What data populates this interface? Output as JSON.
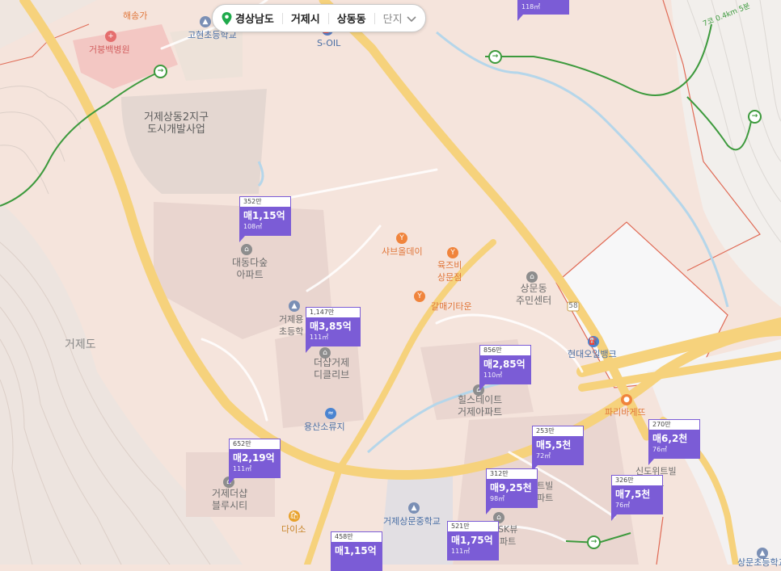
{
  "breadcrumb": {
    "province": "경상남도",
    "city": "거제시",
    "district": "상동동",
    "complex": "단지",
    "location_icon": "location-pin-icon",
    "dropdown_icon": "chevron-down-icon"
  },
  "area_labels": {
    "geojedo": "거제도",
    "dev_project_line1": "거제상동2지구",
    "dev_project_line2": "도시개발사업",
    "trail_distance": "7코 0.4km 5분"
  },
  "road_labels": {
    "route_58": "58"
  },
  "pois": {
    "haesongga": "해송가",
    "hospital": "거붕백병원",
    "gohyeon_school": "고현초등학교",
    "soil": "S-OIL",
    "daedong_apt_line1": "대동다숲",
    "daedong_apt_line2": "아파트",
    "geojeyong_school_line1": "거제용",
    "geojeyong_school_line2": "초등학",
    "shabu": "샤브올데이",
    "yukjeubi_line1": "육즈비",
    "yukjeubi_line2": "상문점",
    "galmaegi": "갈매기타운",
    "sangmun_center_line1": "상문동",
    "sangmun_center_line2": "주민센터",
    "hyundai_oilbank": "현대오일뱅크",
    "the_sharp_line1": "더샵거제",
    "the_sharp_line2": "디클리브",
    "hillstate_line1": "힐스테이트",
    "hillstate_line2": "거제아파트",
    "yongsan_reservoir": "용산소류지",
    "paris_baguette": "파리바게뜨",
    "sharp_bluecity_line1": "거제더샵",
    "sharp_bluecity_line2": "블루시티",
    "daiso": "다이소",
    "sangmun_middle": "거제상문중학교",
    "sk_view_line1": "SK뷰",
    "sk_view_line2": "파트",
    "teubil_line1": "트빌",
    "teubil_line2": "파트",
    "sindo_line1": "신도",
    "sindo_line2": "위트빌",
    "sindo_line3": "파트",
    "sangmun_elem": "상문초등학교"
  },
  "listings": [
    {
      "count": "352만",
      "price": "매1,15억",
      "area": "108㎡"
    },
    {
      "count": "1,147만",
      "price": "매3,85억",
      "area": "111㎡"
    },
    {
      "count": "856만",
      "price": "매2,85억",
      "area": "110㎡"
    },
    {
      "count": "652만",
      "price": "매2,19억",
      "area": "111㎡"
    },
    {
      "count": "253만",
      "price": "매5,5천",
      "area": "72㎡"
    },
    {
      "count": "270만",
      "price": "매6,2천",
      "area": "76㎡"
    },
    {
      "count": "312만",
      "price": "매9,25천",
      "area": "98㎡"
    },
    {
      "count": "326만",
      "price": "매7,5천",
      "area": "76㎡"
    },
    {
      "count": "521만",
      "price": "매1,75억",
      "area": "111㎡"
    },
    {
      "count": "458만",
      "price": "매1,15억",
      "area": ""
    },
    {
      "count": "",
      "price": "",
      "area": "118㎡"
    }
  ],
  "colors": {
    "marker": "#7b5cd6",
    "land": "#f5e4dc",
    "road": "#f6d27c",
    "boundary": "#e06a55",
    "trail": "#3d9a3d",
    "stream": "#b5d6ea"
  }
}
